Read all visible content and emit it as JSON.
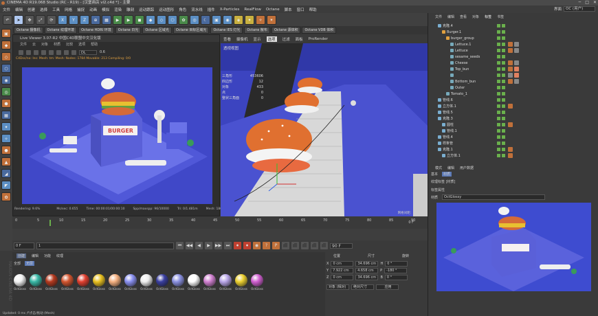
{
  "titlebar": {
    "title": "CINEMA 4D R19.068 Studio (RC - R19) - [汉堡商店 vl2.c4d *] - 主要"
  },
  "window_controls": [
    "─",
    "□",
    "✕"
  ],
  "menubar": [
    "文件",
    "编辑",
    "创建",
    "选择",
    "工具",
    "网格",
    "捕捉",
    "动画",
    "模拟",
    "渲染",
    "雕刻",
    "运动跟踪",
    "运动图形",
    "角色",
    "流水线",
    "插件",
    "X-Particles",
    "RealFlow",
    "Octane",
    "脚本",
    "窗口",
    "帮助"
  ],
  "interface": {
    "label": "界面",
    "value": "OC (用户)"
  },
  "toolbar": [
    "↶",
    "➤",
    "✥",
    "⤢",
    "⟳",
    "X",
    "Y",
    "Z",
    "⊕",
    "▦",
    "▶",
    "▶",
    "◼",
    "◆",
    "◇",
    "⬡",
    "✿",
    "◎",
    "☾",
    "▣",
    "◉",
    "◈",
    "✦",
    "✧",
    "✴"
  ],
  "left_tools": [
    "▣",
    "◆",
    "◇",
    "⬡",
    "◉",
    "◎",
    "⬢",
    "▦",
    "✦",
    "✧",
    "⬣",
    "▲",
    "◢",
    "◤",
    "✿"
  ],
  "octane_tabs": [
    "Octane 摄像机",
    "Octane 纹理环境",
    "Octane HDRI 环境",
    "Octane 日光",
    "Octane 区域光",
    "Octane 目标区域光",
    "Octane IES 灯光",
    "Octane 散布",
    "Octane 源体积",
    "Octane VDB 体积"
  ],
  "live_viewer": {
    "title": "Live Viewer 3.07-R2 中国C4D联盟中文汉化版",
    "menu": [
      "文件",
      "云",
      "对象",
      "材质",
      "比较",
      "选项",
      "帮助"
    ],
    "preset": "DL",
    "preset_value": "0.6",
    "status_line": "C4Dsc/no: Ins: Mesh: tm: Mesh: Nodes: 1784 Movable: 213 Compiling: 0/0",
    "render_stats": [
      "Rendering: 9.6%",
      "Ms/sec: 0.655",
      "Time: 00:00:01/00:00:10",
      "Spp/maxspp: 96/10000",
      "Tri: 0/1.481m",
      "Mesh: 180",
      "Hair: 0",
      "GPU:"
    ],
    "progress": 0.096,
    "sign": "BURGER"
  },
  "viewport": {
    "menu": [
      "查看",
      "摄像机",
      "显示",
      "选项",
      "过滤",
      "面板",
      "ProRender"
    ],
    "active_menu": "选项",
    "label": "透视视图",
    "stats": [
      {
        "k": "三角形",
        "v": "453606"
      },
      {
        "k": "四边形",
        "v": "12"
      },
      {
        "k": "对象",
        "v": "433"
      },
      {
        "k": "点",
        "v": "0"
      },
      {
        "k": "整状三角面",
        "v": "0"
      }
    ],
    "footer": "网格间距：100 cm"
  },
  "timeline": {
    "ticks": [
      "0",
      "5",
      "10",
      "15",
      "20",
      "25",
      "30",
      "35",
      "40",
      "45",
      "50",
      "55",
      "60",
      "65",
      "70",
      "75",
      "80",
      "85",
      "90"
    ],
    "end_label": "0 F",
    "current": "1"
  },
  "transport": {
    "start": "0 F",
    "end": "90 F",
    "buttons": [
      "⏮",
      "◀◀",
      "◀",
      "▶",
      "▶▶",
      "⏭",
      "⏺",
      "⏺",
      "◉",
      "?",
      "P",
      "⬛",
      "⬛",
      "⬛",
      "⬛",
      "⬛"
    ]
  },
  "materials": {
    "tabs": [
      "创建",
      "编辑",
      "功能",
      "纹理"
    ],
    "menu": [
      "全部",
      "无层",
      "",
      ""
    ],
    "active_menu": "无层",
    "items": [
      {
        "name": "OctGloss",
        "color": "#f2f2f2"
      },
      {
        "name": "OctGloss",
        "color": "#39b8a6"
      },
      {
        "name": "OctGloss",
        "color": "#b53a1f"
      },
      {
        "name": "OctGloss",
        "color": "#d2552f"
      },
      {
        "name": "OctGloss",
        "color": "#e14030"
      },
      {
        "name": "OctGloss",
        "color": "#e8c020"
      },
      {
        "name": "OctGloss",
        "color": "#f4b080"
      },
      {
        "name": "OctGloss",
        "color": "#8a90f0"
      },
      {
        "name": "OctGloss",
        "color": "#eeeeee"
      },
      {
        "name": "OctGloss",
        "color": "#3a3fa0"
      },
      {
        "name": "OctGloss",
        "color": "#8a90e0"
      },
      {
        "name": "OctGloss",
        "color": "#ffffff"
      },
      {
        "name": "OctGloss",
        "color": "#d080d0"
      },
      {
        "name": "OctGloss",
        "color": "#b9a6e8"
      },
      {
        "name": "OctGloss",
        "color": "#ecd030"
      },
      {
        "name": "OctGloss",
        "color": "#d060d0"
      }
    ]
  },
  "coordinates": {
    "headers": [
      "位置",
      "尺寸",
      "旋转"
    ],
    "rows": [
      {
        "axis": "X",
        "pos": "0 cm",
        "size": "34.696 cm",
        "rot_axis": "H",
        "rot": "0 °"
      },
      {
        "axis": "Y",
        "pos": "7.922 cm",
        "size": "4.658 cm",
        "rot_axis": "P",
        "rot": "-180 °"
      },
      {
        "axis": "Z",
        "pos": "0 cm",
        "size": "34.696 cm",
        "rot_axis": "B",
        "rot": "0 °"
      }
    ],
    "mode": "对象 (相对)",
    "size_mode": "绝对尺寸",
    "apply": "应用"
  },
  "object_manager": {
    "menu": [
      "文件",
      "编辑",
      "查看",
      "对象",
      "标签",
      "书签"
    ],
    "active_menu": "标签",
    "rows": [
      {
        "indent": 1,
        "label": "克隆.4",
        "color": "#7aaed0",
        "tags": []
      },
      {
        "indent": 2,
        "label": "Burger.1",
        "color": "#e0a040",
        "tags": []
      },
      {
        "indent": 3,
        "label": "burger_group",
        "color": "#e0a040",
        "tags": []
      },
      {
        "indent": 4,
        "label": "Lettuce.1",
        "color": "#7ab",
        "tags": [
          "#c0703a",
          "#888"
        ]
      },
      {
        "indent": 4,
        "label": "Lettuce",
        "color": "#7ab",
        "tags": [
          "#c0703a",
          "#888"
        ]
      },
      {
        "indent": 4,
        "label": "sesame_seeds",
        "color": "#7ab",
        "tags": []
      },
      {
        "indent": 4,
        "label": "Cheese",
        "color": "#7ab",
        "tags": [
          "#c0703a",
          "#888"
        ]
      },
      {
        "indent": 4,
        "label": "Top_bun",
        "color": "#7ab",
        "tags": [
          "#c0703a",
          "#e08060"
        ]
      },
      {
        "indent": 4,
        "label": "",
        "color": "#7ab",
        "tags": [
          "#888",
          "#e08060"
        ]
      },
      {
        "indent": 4,
        "label": "Bottom_bun",
        "color": "#7ab",
        "tags": [
          "#c0703a",
          "#888"
        ]
      },
      {
        "indent": 4,
        "label": "Outer",
        "color": "#7ab",
        "tags": []
      },
      {
        "indent": 3,
        "label": "Tomato_1",
        "color": "#7ab",
        "tags": []
      },
      {
        "indent": 1,
        "label": "管线.6",
        "color": "#7aaed0",
        "tags": []
      },
      {
        "indent": 1,
        "label": "立方体.1",
        "color": "#7aaed0",
        "tags": [
          "#c0703a"
        ]
      },
      {
        "indent": 1,
        "label": "管线.5",
        "color": "#7aaed0",
        "tags": []
      },
      {
        "indent": 1,
        "label": "克隆.3",
        "color": "#7aaed0",
        "tags": []
      },
      {
        "indent": 2,
        "label": "圆柱",
        "color": "#7aaed0",
        "tags": [
          "#c0703a"
        ]
      },
      {
        "indent": 2,
        "label": "管线.1",
        "color": "#7aaed0",
        "tags": []
      },
      {
        "indent": 1,
        "label": "管线.4",
        "color": "#7aaed0",
        "tags": []
      },
      {
        "indent": 1,
        "label": "样条管",
        "color": "#7aaed0",
        "tags": []
      },
      {
        "indent": 1,
        "label": "克隆.1",
        "color": "#7aaed0",
        "tags": [
          "#c0703a"
        ]
      },
      {
        "indent": 2,
        "label": "立方体.1",
        "color": "#7aaed0",
        "tags": [
          "#c0703a"
        ]
      }
    ]
  },
  "attribute_manager": {
    "tabs": [
      "模式",
      "编辑",
      "用户数据"
    ],
    "menu": [
      "基本",
      "材质"
    ],
    "active_menu": "材质",
    "label": "纹理标签 [材质]",
    "sub_label": "标签属性",
    "field_label": "材质",
    "field_value": "OctGlossy"
  },
  "status": "Updated: 0 ms  卢点击/拖动 (Mesh)"
}
